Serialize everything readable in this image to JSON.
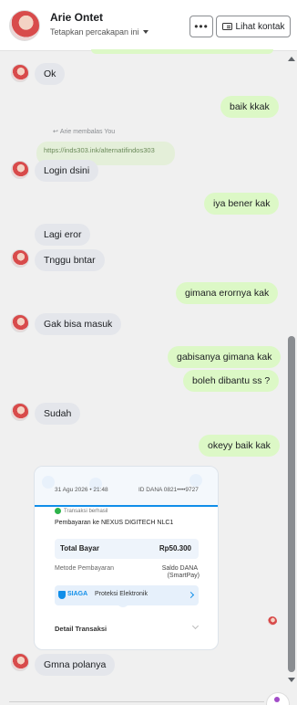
{
  "header": {
    "contact_name": "Arie Ontet",
    "pin_label": "Tetapkan percakapan ini",
    "more_label": "•••",
    "view_contact_label": "Lihat kontak"
  },
  "messages": [
    {
      "side": "in",
      "text": "Ok"
    },
    {
      "side": "out",
      "text": "baik kkak"
    },
    {
      "side": "in",
      "text": "Login dsini"
    },
    {
      "side": "out",
      "text": "iya bener kak"
    },
    {
      "side": "in",
      "text": "Lagi eror"
    },
    {
      "side": "in",
      "text": "Tnggu bntar"
    },
    {
      "side": "out",
      "text": "gimana erornya kak"
    },
    {
      "side": "in",
      "text": "Gak bisa masuk"
    },
    {
      "side": "out",
      "text": "gabisanya gimana kak"
    },
    {
      "side": "out",
      "text": "boleh dibantu ss ?"
    },
    {
      "side": "in",
      "text": "Sudah"
    },
    {
      "side": "out",
      "text": "okeyy baik kak"
    },
    {
      "side": "in",
      "text": "Gmna polanya"
    }
  ],
  "reply": {
    "label": "Arie membalas You",
    "quoted_text": "https://inds303.ink/alternatifindos303"
  },
  "receipt": {
    "date": "31 Agu 2026 • 21:48",
    "id": "ID DANA 0821••••9727",
    "status": "Transaksi berhasil",
    "merchant": "Pembayaran ke NEXUS DIGITECH NLC1",
    "total_label": "Total Bayar",
    "total_value": "Rp50.300",
    "method_label": "Metode Pembayaran",
    "method_value_1": "Saldo DANA",
    "method_value_2": "(SmartPay)",
    "siaga_brand": "SIAGA",
    "siaga_text": "Proteksi Elektronik",
    "detail_label": "Detail Transaksi"
  }
}
